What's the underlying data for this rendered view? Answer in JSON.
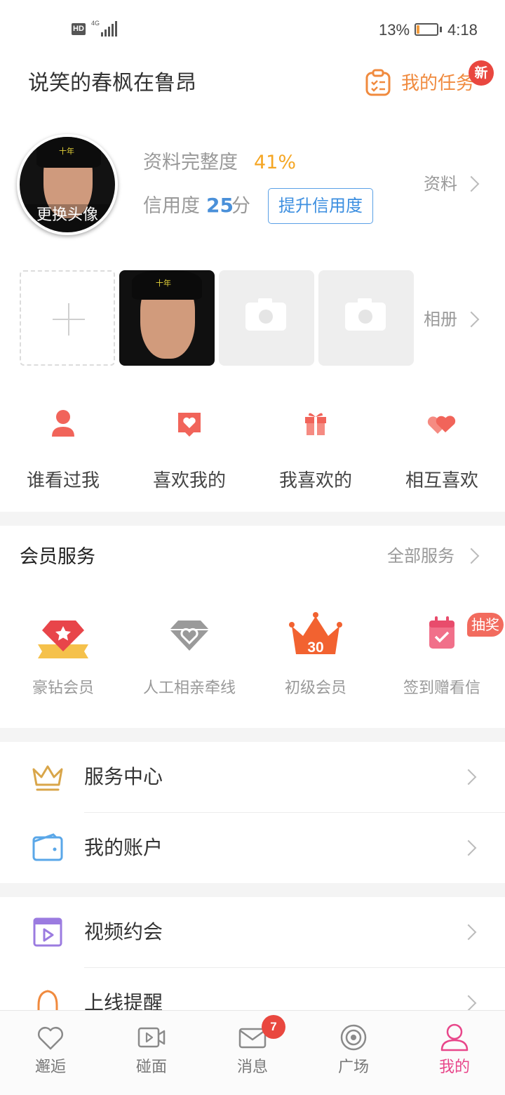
{
  "status_bar": {
    "hd": "HD",
    "network": "4G",
    "battery_percent": "13%",
    "battery_level": 0.13,
    "time": "4:18"
  },
  "header": {
    "username": "说笑的春枫在鲁昂",
    "task_label": "我的任务",
    "task_badge": "新",
    "task_icon": "task-list-icon"
  },
  "profile": {
    "avatar_label": "更换头像",
    "avatar_watermark": "十年",
    "completeness_label": "资料完整度",
    "completeness_value": "41%",
    "credit_label": "信用度",
    "credit_value": "25",
    "credit_unit": "分",
    "credit_button": "提升信用度",
    "profile_link": "资料"
  },
  "album": {
    "add_icon": "plus-icon",
    "photo_watermark": "十年",
    "placeholder_icon": "camera-icon",
    "link": "相册"
  },
  "quick_actions": [
    {
      "label": "谁看过我",
      "icon": "person-icon"
    },
    {
      "label": "喜欢我的",
      "icon": "heart-bubble-icon"
    },
    {
      "label": "我喜欢的",
      "icon": "gift-icon"
    },
    {
      "label": "相互喜欢",
      "icon": "double-heart-icon"
    }
  ],
  "membership": {
    "title": "会员服务",
    "all_services": "全部服务",
    "items": [
      {
        "label": "豪钻会员",
        "icon": "diamond-icon"
      },
      {
        "label": "人工相亲牵线",
        "icon": "gray-diamond-icon"
      },
      {
        "label": "初级会员",
        "icon": "crown-icon",
        "crown_text": "30"
      },
      {
        "label": "签到赠看信",
        "icon": "calendar-check-icon"
      }
    ],
    "lottery_badge": "抽奖"
  },
  "list_group_1": [
    {
      "label": "服务中心",
      "icon": "crown-outline-icon"
    },
    {
      "label": "我的账户",
      "icon": "wallet-icon"
    }
  ],
  "list_group_2": [
    {
      "label": "视频约会",
      "icon": "video-date-icon"
    },
    {
      "label": "上线提醒",
      "icon": "bell-icon"
    }
  ],
  "tabbar": {
    "tabs": [
      {
        "label": "邂逅",
        "icon": "heart-outline-icon"
      },
      {
        "label": "碰面",
        "icon": "video-camera-icon"
      },
      {
        "label": "消息",
        "icon": "mail-icon"
      },
      {
        "label": "广场",
        "icon": "planet-icon"
      },
      {
        "label": "我的",
        "icon": "user-icon"
      }
    ],
    "message_badge": "7",
    "active": "我的"
  },
  "colors": {
    "accent_orange": "#f08a3e",
    "accent_pink": "#e8468a",
    "badge_red": "#e9473f",
    "link_blue": "#3d8fe0",
    "rating_yellow": "#f5a623"
  }
}
